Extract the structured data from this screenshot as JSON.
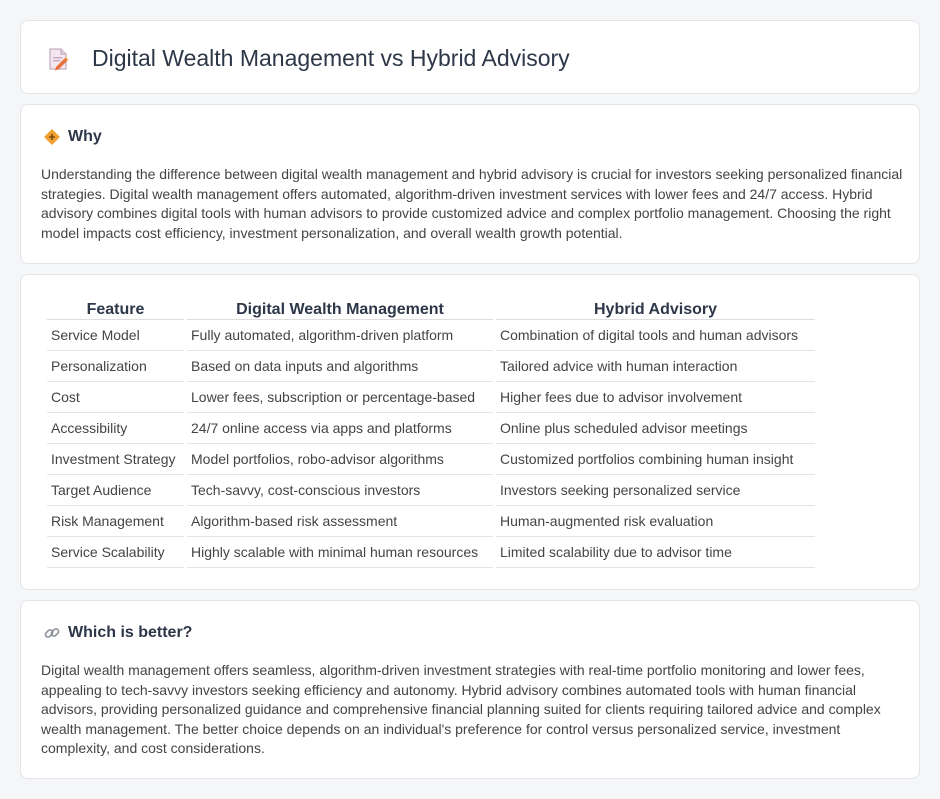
{
  "header": {
    "title": "Digital Wealth Management vs Hybrid Advisory",
    "icon": "document-pencil-icon"
  },
  "why": {
    "title": "Why",
    "icon": "diamond-sign-icon",
    "text": "Understanding the difference between digital wealth management and hybrid advisory is crucial for investors seeking personalized financial strategies. Digital wealth management offers automated, algorithm-driven investment services with lower fees and 24/7 access. Hybrid advisory combines digital tools with human advisors to provide customized advice and complex portfolio management. Choosing the right model impacts cost efficiency, investment personalization, and overall wealth growth potential."
  },
  "table": {
    "headers": [
      "Feature",
      "Digital Wealth Management",
      "Hybrid Advisory"
    ],
    "rows": [
      [
        "Service Model",
        "Fully automated, algorithm-driven platform",
        "Combination of digital tools and human advisors"
      ],
      [
        "Personalization",
        "Based on data inputs and algorithms",
        "Tailored advice with human interaction"
      ],
      [
        "Cost",
        "Lower fees, subscription or percentage-based",
        "Higher fees due to advisor involvement"
      ],
      [
        "Accessibility",
        "24/7 online access via apps and platforms",
        "Online plus scheduled advisor meetings"
      ],
      [
        "Investment Strategy",
        "Model portfolios, robo-advisor algorithms",
        "Customized portfolios combining human insight"
      ],
      [
        "Target Audience",
        "Tech-savvy, cost-conscious investors",
        "Investors seeking personalized service"
      ],
      [
        "Risk Management",
        "Algorithm-based risk assessment",
        "Human-augmented risk evaluation"
      ],
      [
        "Service Scalability",
        "Highly scalable with minimal human resources",
        "Limited scalability due to advisor time"
      ]
    ]
  },
  "better": {
    "title": "Which is better?",
    "icon": "link-icon",
    "text": "Digital wealth management offers seamless, algorithm-driven investment strategies with real-time portfolio monitoring and lower fees, appealing to tech-savvy investors seeking efficiency and autonomy. Hybrid advisory combines automated tools with human financial advisors, providing personalized guidance and comprehensive financial planning suited for clients requiring tailored advice and complex wealth management. The better choice depends on an individual's preference for control versus personalized service, investment complexity, and cost considerations."
  },
  "colors": {
    "accent": "#f0a030",
    "title": "#2d3748",
    "text": "#444444"
  }
}
